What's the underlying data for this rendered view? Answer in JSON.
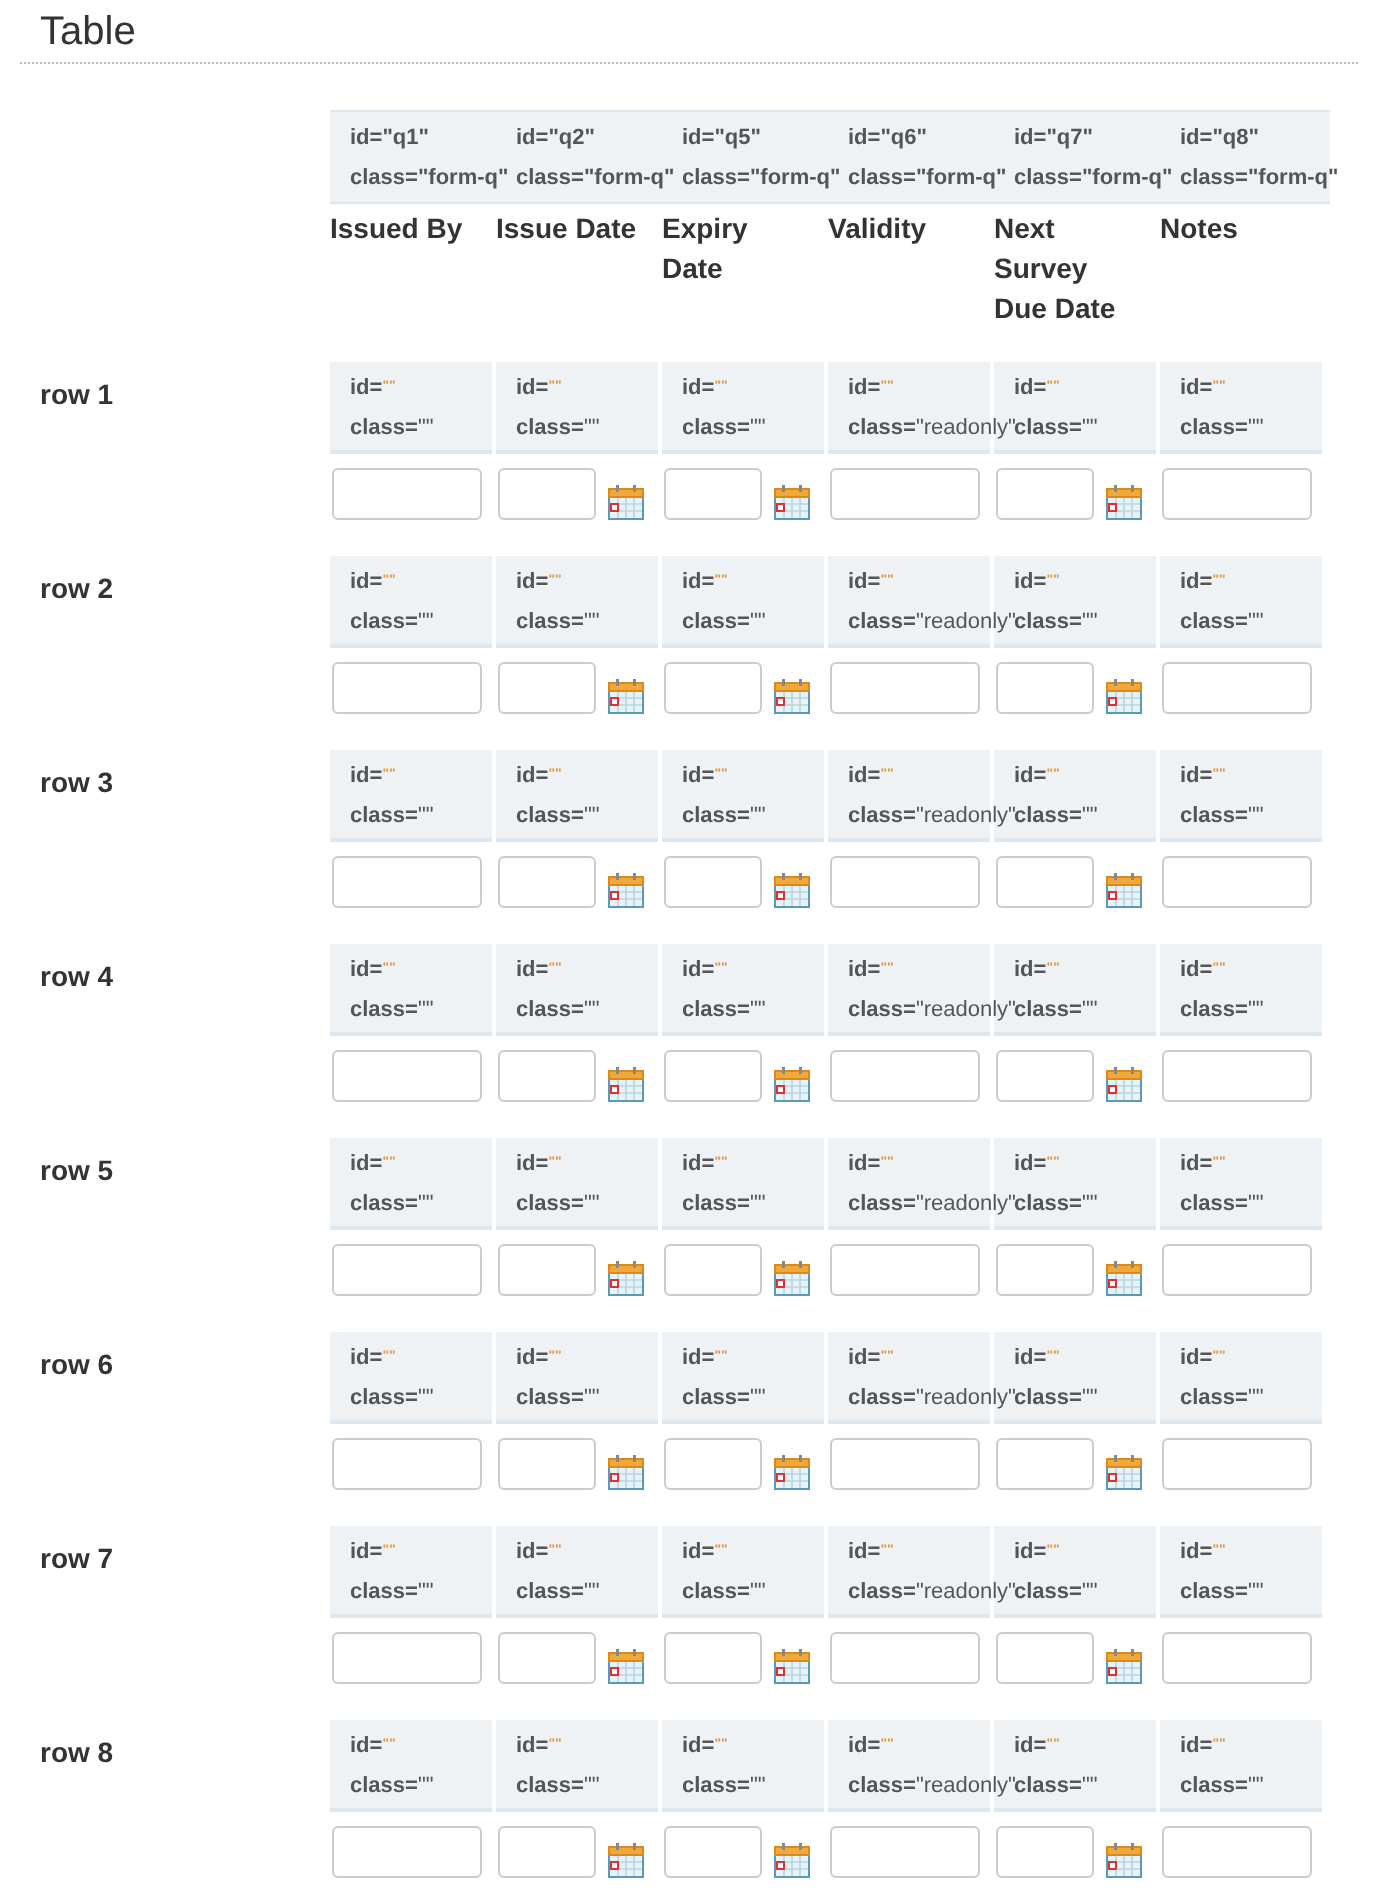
{
  "title": "Table",
  "columns": [
    {
      "id_text": "id=\"q1\"",
      "class_text": "class=\"form-q\"",
      "heading": "Issued By"
    },
    {
      "id_text": "id=\"q2\"",
      "class_text": "class=\"form-q\"",
      "heading": "Issue Date"
    },
    {
      "id_text": "id=\"q5\"",
      "class_text": "class=\"form-q\"",
      "heading": "Expiry Date"
    },
    {
      "id_text": "id=\"q6\"",
      "class_text": "class=\"form-q\"",
      "heading": "Validity"
    },
    {
      "id_text": "id=\"q7\"",
      "class_text": "class=\"form-q\"",
      "heading": "Next Survey Due Date"
    },
    {
      "id_text": "id=\"q8\"",
      "class_text": "class=\"form-q\"",
      "heading": "Notes"
    }
  ],
  "rows": [
    {
      "label": "row 1",
      "cells": [
        {
          "kind": "text",
          "id_label": "id=",
          "id_value": "\"\"",
          "class_label": "class=",
          "class_value": "\"\""
        },
        {
          "kind": "date",
          "id_label": "id=",
          "id_value": "\"\"",
          "class_label": "class=",
          "class_value": "\"\""
        },
        {
          "kind": "date",
          "id_label": "id=",
          "id_value": "\"\"",
          "class_label": "class=",
          "class_value": "\"\""
        },
        {
          "kind": "text",
          "id_label": "id=",
          "id_value": "\"\"",
          "class_label": "class=",
          "class_value": "\"readonly\""
        },
        {
          "kind": "date",
          "id_label": "id=",
          "id_value": "\"\"",
          "class_label": "class=",
          "class_value": "\"\""
        },
        {
          "kind": "text",
          "id_label": "id=",
          "id_value": "\"\"",
          "class_label": "class=",
          "class_value": "\"\""
        }
      ]
    },
    {
      "label": "row 2",
      "cells": [
        {
          "kind": "text",
          "id_label": "id=",
          "id_value": "\"\"",
          "class_label": "class=",
          "class_value": "\"\""
        },
        {
          "kind": "date",
          "id_label": "id=",
          "id_value": "\"\"",
          "class_label": "class=",
          "class_value": "\"\""
        },
        {
          "kind": "date",
          "id_label": "id=",
          "id_value": "\"\"",
          "class_label": "class=",
          "class_value": "\"\""
        },
        {
          "kind": "text",
          "id_label": "id=",
          "id_value": "\"\"",
          "class_label": "class=",
          "class_value": "\"readonly\""
        },
        {
          "kind": "date",
          "id_label": "id=",
          "id_value": "\"\"",
          "class_label": "class=",
          "class_value": "\"\""
        },
        {
          "kind": "text",
          "id_label": "id=",
          "id_value": "\"\"",
          "class_label": "class=",
          "class_value": "\"\""
        }
      ]
    },
    {
      "label": "row 3",
      "cells": [
        {
          "kind": "text",
          "id_label": "id=",
          "id_value": "\"\"",
          "class_label": "class=",
          "class_value": "\"\""
        },
        {
          "kind": "date",
          "id_label": "id=",
          "id_value": "\"\"",
          "class_label": "class=",
          "class_value": "\"\""
        },
        {
          "kind": "date",
          "id_label": "id=",
          "id_value": "\"\"",
          "class_label": "class=",
          "class_value": "\"\""
        },
        {
          "kind": "text",
          "id_label": "id=",
          "id_value": "\"\"",
          "class_label": "class=",
          "class_value": "\"readonly\""
        },
        {
          "kind": "date",
          "id_label": "id=",
          "id_value": "\"\"",
          "class_label": "class=",
          "class_value": "\"\""
        },
        {
          "kind": "text",
          "id_label": "id=",
          "id_value": "\"\"",
          "class_label": "class=",
          "class_value": "\"\""
        }
      ]
    },
    {
      "label": "row 4",
      "cells": [
        {
          "kind": "text",
          "id_label": "id=",
          "id_value": "\"\"",
          "class_label": "class=",
          "class_value": "\"\""
        },
        {
          "kind": "date",
          "id_label": "id=",
          "id_value": "\"\"",
          "class_label": "class=",
          "class_value": "\"\""
        },
        {
          "kind": "date",
          "id_label": "id=",
          "id_value": "\"\"",
          "class_label": "class=",
          "class_value": "\"\""
        },
        {
          "kind": "text",
          "id_label": "id=",
          "id_value": "\"\"",
          "class_label": "class=",
          "class_value": "\"readonly\""
        },
        {
          "kind": "date",
          "id_label": "id=",
          "id_value": "\"\"",
          "class_label": "class=",
          "class_value": "\"\""
        },
        {
          "kind": "text",
          "id_label": "id=",
          "id_value": "\"\"",
          "class_label": "class=",
          "class_value": "\"\""
        }
      ]
    },
    {
      "label": "row 5",
      "cells": [
        {
          "kind": "text",
          "id_label": "id=",
          "id_value": "\"\"",
          "class_label": "class=",
          "class_value": "\"\""
        },
        {
          "kind": "date",
          "id_label": "id=",
          "id_value": "\"\"",
          "class_label": "class=",
          "class_value": "\"\""
        },
        {
          "kind": "date",
          "id_label": "id=",
          "id_value": "\"\"",
          "class_label": "class=",
          "class_value": "\"\""
        },
        {
          "kind": "text",
          "id_label": "id=",
          "id_value": "\"\"",
          "class_label": "class=",
          "class_value": "\"readonly\""
        },
        {
          "kind": "date",
          "id_label": "id=",
          "id_value": "\"\"",
          "class_label": "class=",
          "class_value": "\"\""
        },
        {
          "kind": "text",
          "id_label": "id=",
          "id_value": "\"\"",
          "class_label": "class=",
          "class_value": "\"\""
        }
      ]
    },
    {
      "label": "row 6",
      "cells": [
        {
          "kind": "text",
          "id_label": "id=",
          "id_value": "\"\"",
          "class_label": "class=",
          "class_value": "\"\""
        },
        {
          "kind": "date",
          "id_label": "id=",
          "id_value": "\"\"",
          "class_label": "class=",
          "class_value": "\"\""
        },
        {
          "kind": "date",
          "id_label": "id=",
          "id_value": "\"\"",
          "class_label": "class=",
          "class_value": "\"\""
        },
        {
          "kind": "text",
          "id_label": "id=",
          "id_value": "\"\"",
          "class_label": "class=",
          "class_value": "\"readonly\""
        },
        {
          "kind": "date",
          "id_label": "id=",
          "id_value": "\"\"",
          "class_label": "class=",
          "class_value": "\"\""
        },
        {
          "kind": "text",
          "id_label": "id=",
          "id_value": "\"\"",
          "class_label": "class=",
          "class_value": "\"\""
        }
      ]
    },
    {
      "label": "row 7",
      "cells": [
        {
          "kind": "text",
          "id_label": "id=",
          "id_value": "\"\"",
          "class_label": "class=",
          "class_value": "\"\""
        },
        {
          "kind": "date",
          "id_label": "id=",
          "id_value": "\"\"",
          "class_label": "class=",
          "class_value": "\"\""
        },
        {
          "kind": "date",
          "id_label": "id=",
          "id_value": "\"\"",
          "class_label": "class=",
          "class_value": "\"\""
        },
        {
          "kind": "text",
          "id_label": "id=",
          "id_value": "\"\"",
          "class_label": "class=",
          "class_value": "\"readonly\""
        },
        {
          "kind": "date",
          "id_label": "id=",
          "id_value": "\"\"",
          "class_label": "class=",
          "class_value": "\"\""
        },
        {
          "kind": "text",
          "id_label": "id=",
          "id_value": "\"\"",
          "class_label": "class=",
          "class_value": "\"\""
        }
      ]
    },
    {
      "label": "row 8",
      "cells": [
        {
          "kind": "text",
          "id_label": "id=",
          "id_value": "\"\"",
          "class_label": "class=",
          "class_value": "\"\""
        },
        {
          "kind": "date",
          "id_label": "id=",
          "id_value": "\"\"",
          "class_label": "class=",
          "class_value": "\"\""
        },
        {
          "kind": "date",
          "id_label": "id=",
          "id_value": "\"\"",
          "class_label": "class=",
          "class_value": "\"\""
        },
        {
          "kind": "text",
          "id_label": "id=",
          "id_value": "\"\"",
          "class_label": "class=",
          "class_value": "\"readonly\""
        },
        {
          "kind": "date",
          "id_label": "id=",
          "id_value": "\"\"",
          "class_label": "class=",
          "class_value": "\"\""
        },
        {
          "kind": "text",
          "id_label": "id=",
          "id_value": "\"\"",
          "class_label": "class=",
          "class_value": "\"\""
        }
      ]
    }
  ]
}
